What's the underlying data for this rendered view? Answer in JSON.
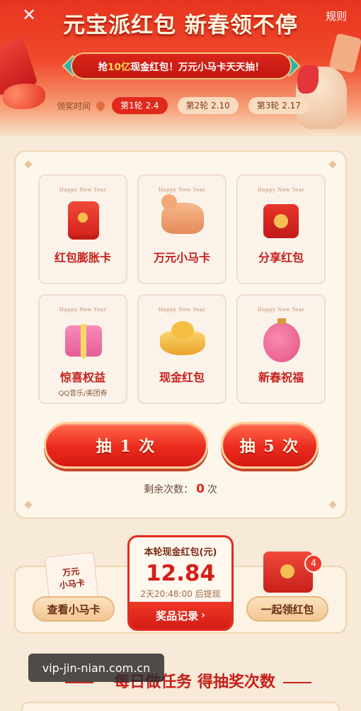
{
  "header": {
    "close_icon": "close-icon",
    "title": "元宝派红包 新春领不停",
    "rules": "规则",
    "banner": {
      "prefix": "抢",
      "highlight": "10亿",
      "suffix": "现金红包！万元小马卡天天抽！"
    },
    "round_label": "领奖时间",
    "rounds": [
      {
        "label": "第1轮 2.4",
        "active": true
      },
      {
        "label": "第2轮 2.10",
        "active": false
      },
      {
        "label": "第3轮 2.17",
        "active": false
      }
    ]
  },
  "prizes": {
    "card_header": "Happy New Year",
    "items": [
      {
        "name": "红包膨胀卡",
        "sub": "",
        "icon": "inflate-envelope-icon"
      },
      {
        "name": "万元小马卡",
        "sub": "",
        "icon": "pony-icon"
      },
      {
        "name": "分享红包",
        "sub": "",
        "icon": "share-envelope-icon"
      },
      {
        "name": "惊喜权益",
        "sub": "QQ音乐/美团券",
        "icon": "gift-box-icon"
      },
      {
        "name": "现金红包",
        "sub": "",
        "icon": "gold-ingot-icon"
      },
      {
        "name": "新春祝福",
        "sub": "",
        "icon": "lantern-icon"
      }
    ]
  },
  "actions": {
    "draw_one": "抽 1 次",
    "draw_five": "抽 5 次",
    "remaining_label": "剩余次数：",
    "remaining_count": "0",
    "remaining_unit": "次"
  },
  "bottom": {
    "view_horse": "查看小马卡",
    "horse_card_line1": "万元",
    "horse_card_line2": "小马卡",
    "cash_title": "本轮现金红包(元)",
    "cash_amount": "12.84",
    "cash_time": "2天20:48:00 后提现",
    "records": "奖品记录",
    "together": "一起领红包",
    "badge_count": "4"
  },
  "watermark": "vip-jin-nian.com.cn",
  "section_title": "每日做任务 得抽奖次数",
  "colors": {
    "accent": "#e0291c",
    "panel": "#fdf6ea",
    "gold": "#f6c27a"
  }
}
